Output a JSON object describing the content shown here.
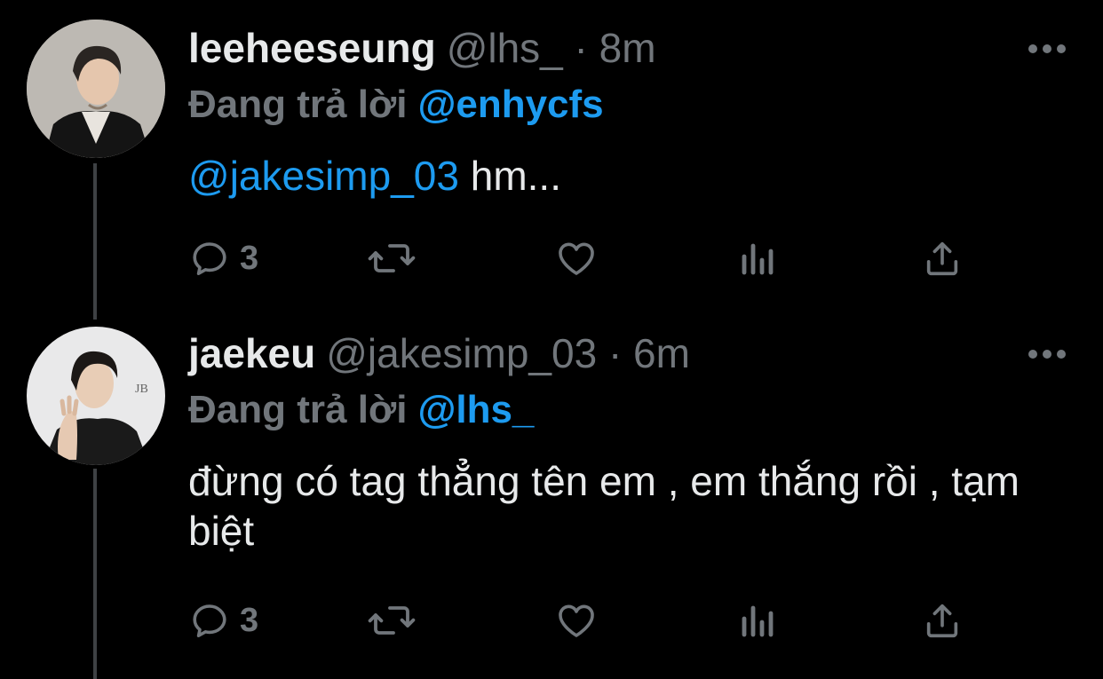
{
  "colors": {
    "background": "#000000",
    "text": "#e7e9ea",
    "secondary": "#71767b",
    "link": "#1d9bf0",
    "thread_line": "#3e4144"
  },
  "tweets": [
    {
      "display_name": "leeheeseung",
      "handle_time": "@lhs_ · 8m",
      "replying_label": "Đang trả lời",
      "replying_to": "@enhycfs",
      "mention": "@jakesimp_03",
      "text": " hm...",
      "reply_count": "3",
      "icons": [
        "reply-icon",
        "retweet-icon",
        "like-icon",
        "analytics-icon",
        "share-icon"
      ]
    },
    {
      "display_name": "jaekeu",
      "handle_time": "@jakesimp_03 · 6m",
      "replying_label": "Đang trả lời",
      "replying_to": "@lhs_",
      "mention": "",
      "text": "đừng có tag thẳng tên em , em thắng rồi , tạm biệt",
      "reply_count": "3",
      "icons": [
        "reply-icon",
        "retweet-icon",
        "like-icon",
        "analytics-icon",
        "share-icon"
      ]
    }
  ]
}
